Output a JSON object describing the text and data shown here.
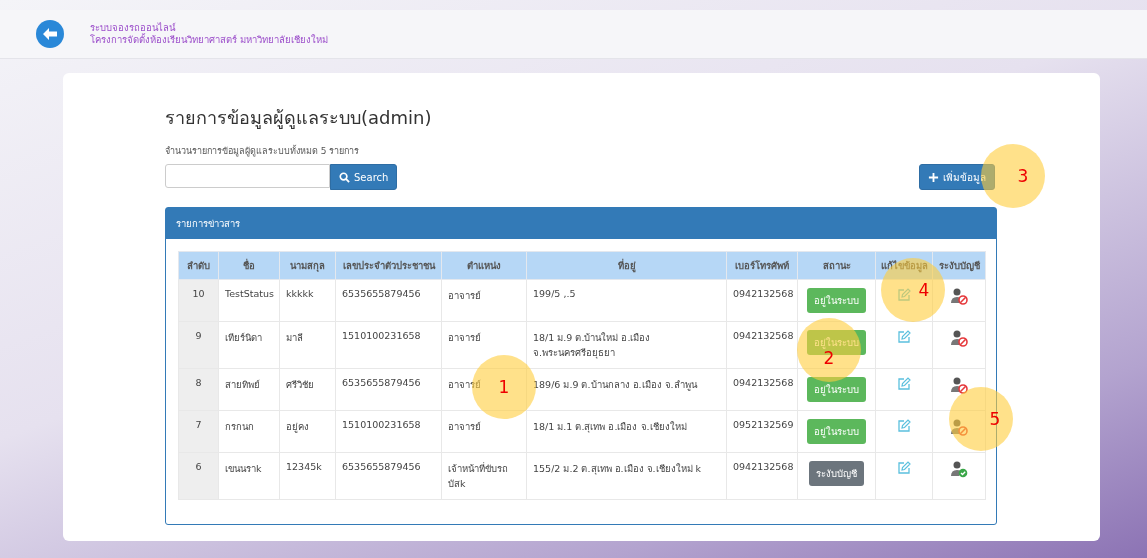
{
  "header": {
    "line_1": "ระบบจองรถออนไลน์",
    "line_2": "โครงการจัดตั้งห้องเรียนวิทยาศาสตร์ มหาวิทยาลัยเชียงใหม่"
  },
  "page": {
    "title": "รายการข้อมูลผู้ดูแลระบบ(admin)",
    "summary": "จำนวนรายการข้อมูลผู้ดูแลระบบทั้งหมด 5 รายการ",
    "search_button": "Search",
    "add_button": "เพิ่มข้อมูล"
  },
  "panel": {
    "title": "รายการข่าวสาร"
  },
  "table": {
    "columns": [
      "ลำดับ",
      "ชื่อ",
      "นามสกุล",
      "เลขประจำตัวประชาชน",
      "ตำแหน่ง",
      "ที่อยู่",
      "เบอร์โทรศัพท์",
      "สถานะ",
      "แก้ไขข้อมูล",
      "ระงับบัญชี"
    ],
    "rows": [
      {
        "no": "10",
        "first_name": "TestStatus",
        "last_name": "kkkkk",
        "id_number": "6535655879456",
        "position": "อาจารย์",
        "address": "199/5 ,.5",
        "phone": "0942132568",
        "status": {
          "kind": "active",
          "label": "อยู่ในระบบ"
        }
      },
      {
        "no": "9",
        "first_name": "เทียร์นิดา",
        "last_name": "มาลี",
        "id_number": "1510100231658",
        "position": "อาจารย์",
        "address": "18/1 ม.9 ต.บ้านใหม่ อ.เมือง จ.พระนครศรีอยุธยา",
        "phone": "0942132568",
        "status": {
          "kind": "active",
          "label": "อยู่ในระบบ"
        }
      },
      {
        "no": "8",
        "first_name": "สายทิพย์",
        "last_name": "ศรีวิชัย",
        "id_number": "6535655879456",
        "position": "อาจารย์",
        "address": "189/6 ม.9 ต.บ้านกลาง อ.เมือง จ.ลำพูน",
        "phone": "0942132568",
        "status": {
          "kind": "active",
          "label": "อยู่ในระบบ"
        }
      },
      {
        "no": "7",
        "first_name": "กรกนก",
        "last_name": "อยู่คง",
        "id_number": "1510100231658",
        "position": "อาจารย์",
        "address": "18/1 ม.1 ต.สุเทพ อ.เมือง จ.เชียงใหม่",
        "phone": "0952132569",
        "status": {
          "kind": "active",
          "label": "อยู่ในระบบ"
        }
      },
      {
        "no": "6",
        "first_name": "เขนนราk",
        "last_name": "12345k",
        "id_number": "6535655879456",
        "position": "เจ้าหน้าที่ขับรถบัสk",
        "address": "155/2 ม.2 ต.สุเทพ อ.เมือง จ.เชียงใหม่ k",
        "phone": "0942132568",
        "status": {
          "kind": "suspended",
          "label": "ระงับบัญชี"
        }
      }
    ]
  },
  "callouts": [
    "1",
    "2",
    "3",
    "4",
    "5"
  ]
}
